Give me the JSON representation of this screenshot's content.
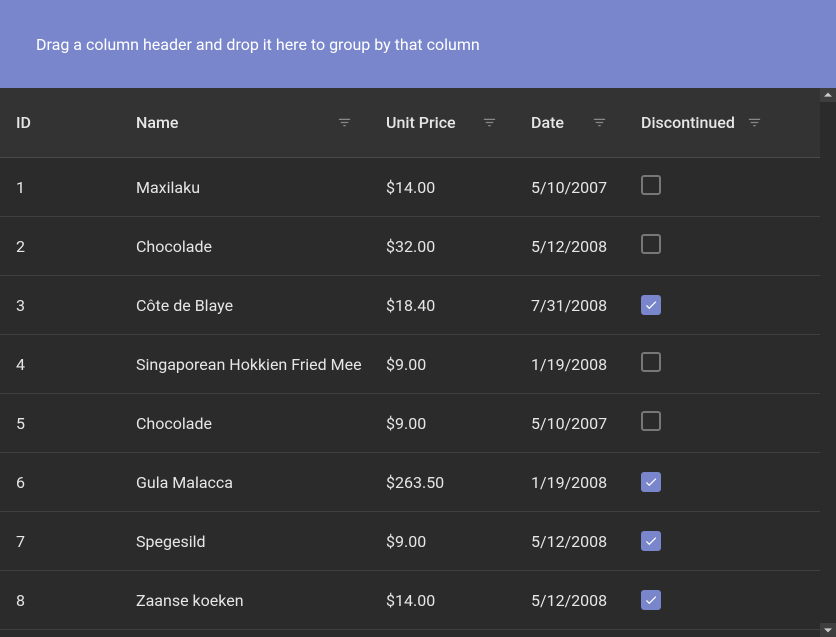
{
  "groupPanel": {
    "hint": "Drag a column header and drop it here to group by that column"
  },
  "columns": {
    "id": {
      "label": "ID"
    },
    "name": {
      "label": "Name"
    },
    "price": {
      "label": "Unit Price"
    },
    "date": {
      "label": "Date"
    },
    "disc": {
      "label": "Discontinued"
    }
  },
  "rows": [
    {
      "id": "1",
      "name": "Maxilaku",
      "price": "$14.00",
      "date": "5/10/2007",
      "disc": false
    },
    {
      "id": "2",
      "name": "Chocolade",
      "price": "$32.00",
      "date": "5/12/2008",
      "disc": false
    },
    {
      "id": "3",
      "name": "Côte de Blaye",
      "price": "$18.40",
      "date": "7/31/2008",
      "disc": true
    },
    {
      "id": "4",
      "name": "Singaporean Hokkien Fried Mee",
      "price": "$9.00",
      "date": "1/19/2008",
      "disc": false
    },
    {
      "id": "5",
      "name": "Chocolade",
      "price": "$9.00",
      "date": "5/10/2007",
      "disc": false
    },
    {
      "id": "6",
      "name": "Gula Malacca",
      "price": "$263.50",
      "date": "1/19/2008",
      "disc": true
    },
    {
      "id": "7",
      "name": "Spegesild",
      "price": "$9.00",
      "date": "5/12/2008",
      "disc": true
    },
    {
      "id": "8",
      "name": "Zaanse koeken",
      "price": "$14.00",
      "date": "5/12/2008",
      "disc": true
    }
  ]
}
